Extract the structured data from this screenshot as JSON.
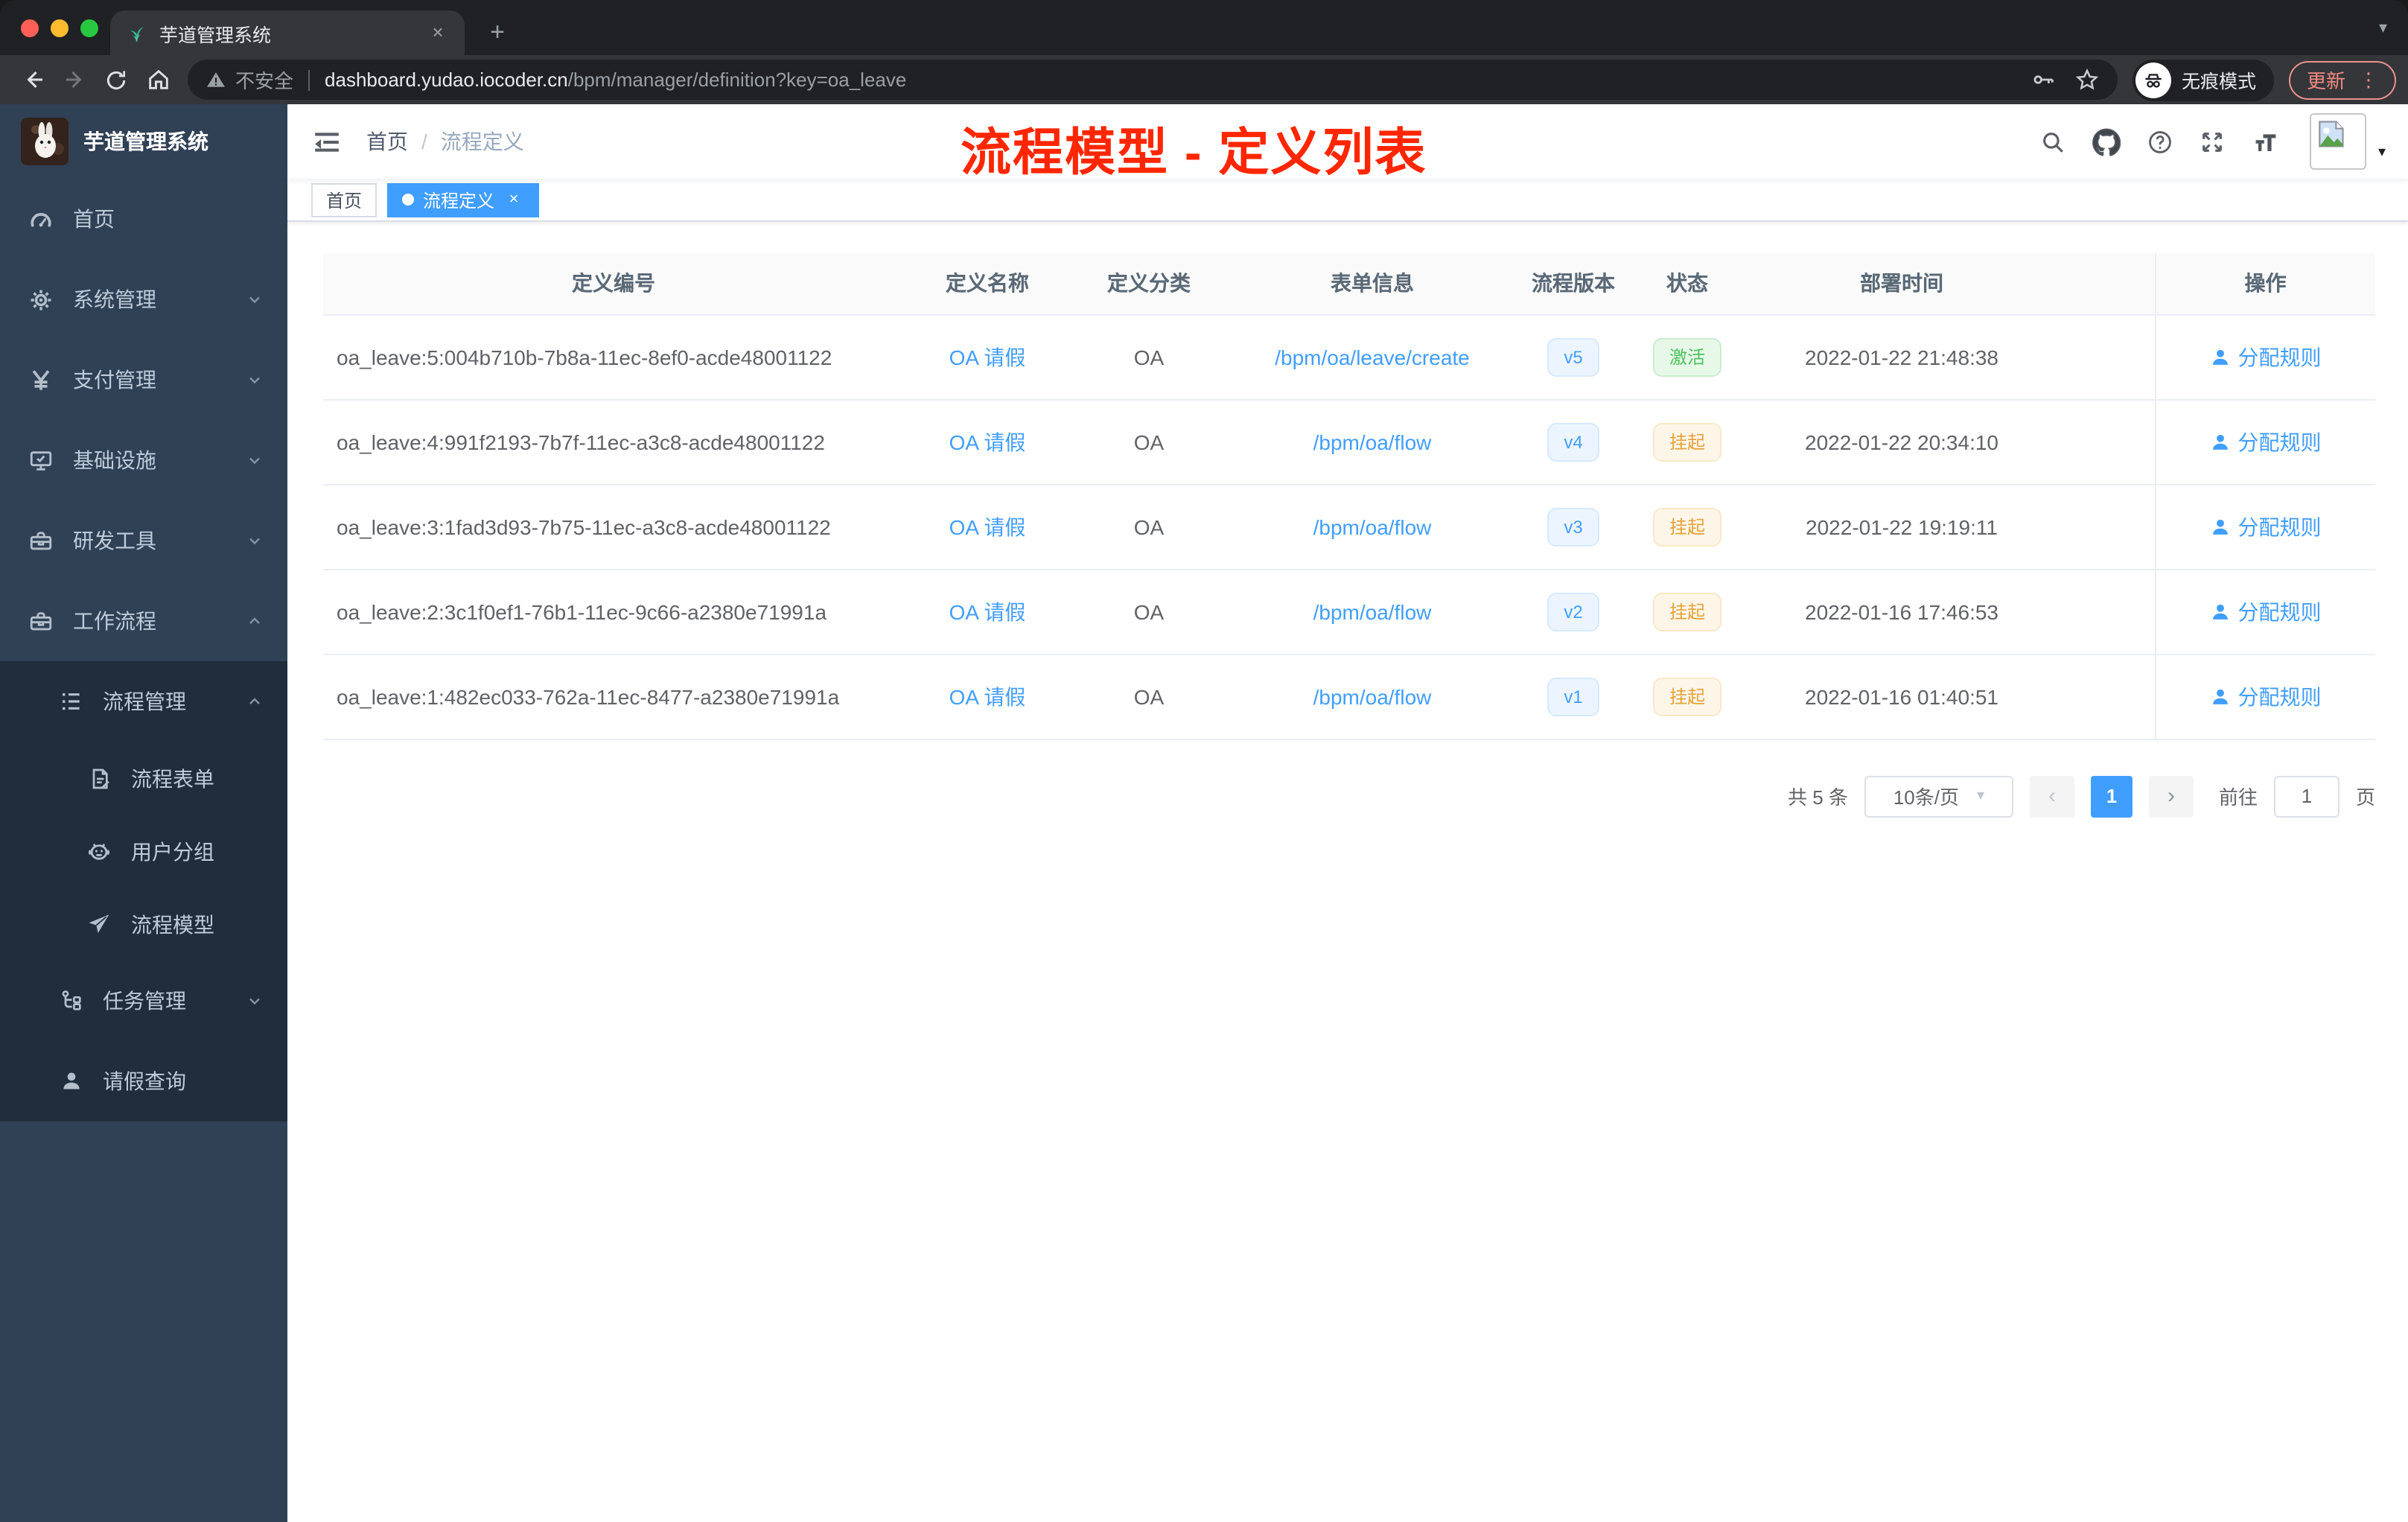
{
  "browser": {
    "tab_title": "芋道管理系统",
    "security_label": "不安全",
    "url_host": "dashboard.yudao.iocoder.cn",
    "url_path": "/bpm/manager/definition?key=oa_leave",
    "incognito_label": "无痕模式",
    "update_label": "更新"
  },
  "glyphs": {
    "close": "×",
    "plus": "+",
    "kebab": "⋮",
    "caret_down": "▾",
    "prev": "‹",
    "next": "›",
    "select_caret": "▾"
  },
  "sidebar": {
    "app_title": "芋道管理系统",
    "items": [
      {
        "label": "首页"
      },
      {
        "label": "系统管理"
      },
      {
        "label": "支付管理"
      },
      {
        "label": "基础设施"
      },
      {
        "label": "研发工具"
      },
      {
        "label": "工作流程"
      },
      {
        "label": "流程管理"
      },
      {
        "label": "流程表单"
      },
      {
        "label": "用户分组"
      },
      {
        "label": "流程模型"
      },
      {
        "label": "任务管理"
      },
      {
        "label": "请假查询"
      }
    ]
  },
  "navbar": {
    "breadcrumb_home": "首页",
    "breadcrumb_sep": "/",
    "breadcrumb_current": "流程定义",
    "annotation": "流程模型 - 定义列表"
  },
  "tags": {
    "home": "首页",
    "current": "流程定义"
  },
  "table": {
    "columns": [
      "定义编号",
      "定义名称",
      "定义分类",
      "表单信息",
      "流程版本",
      "状态",
      "部署时间",
      "操作"
    ],
    "rows": [
      {
        "id": "oa_leave:5:004b710b-7b8a-11ec-8ef0-acde48001122",
        "name": "OA 请假",
        "category": "OA",
        "form": "/bpm/oa/leave/create",
        "version": "v5",
        "status": "激活",
        "time": "2022-01-22 21:48:38",
        "action": "分配规则"
      },
      {
        "id": "oa_leave:4:991f2193-7b7f-11ec-a3c8-acde48001122",
        "name": "OA 请假",
        "category": "OA",
        "form": "/bpm/oa/flow",
        "version": "v4",
        "status": "挂起",
        "time": "2022-01-22 20:34:10",
        "action": "分配规则"
      },
      {
        "id": "oa_leave:3:1fad3d93-7b75-11ec-a3c8-acde48001122",
        "name": "OA 请假",
        "category": "OA",
        "form": "/bpm/oa/flow",
        "version": "v3",
        "status": "挂起",
        "time": "2022-01-22 19:19:11",
        "action": "分配规则"
      },
      {
        "id": "oa_leave:2:3c1f0ef1-76b1-11ec-9c66-a2380e71991a",
        "name": "OA 请假",
        "category": "OA",
        "form": "/bpm/oa/flow",
        "version": "v2",
        "status": "挂起",
        "time": "2022-01-16 17:46:53",
        "action": "分配规则"
      },
      {
        "id": "oa_leave:1:482ec033-762a-11ec-8477-a2380e71991a",
        "name": "OA 请假",
        "category": "OA",
        "form": "/bpm/oa/flow",
        "version": "v1",
        "status": "挂起",
        "time": "2022-01-16 01:40:51",
        "action": "分配规则"
      }
    ]
  },
  "pagination": {
    "total": "共 5 条",
    "page_size": "10条/页",
    "current": "1",
    "goto": "前往",
    "goto_value": "1",
    "unit": "页"
  },
  "colors": {
    "accent": "#409eff",
    "status_active": "#4bc35c",
    "status_suspended": "#e6a23c",
    "annotation_red": "#ff2600",
    "sidebar_bg": "#304156",
    "submenu_bg": "#1f2d3d"
  }
}
